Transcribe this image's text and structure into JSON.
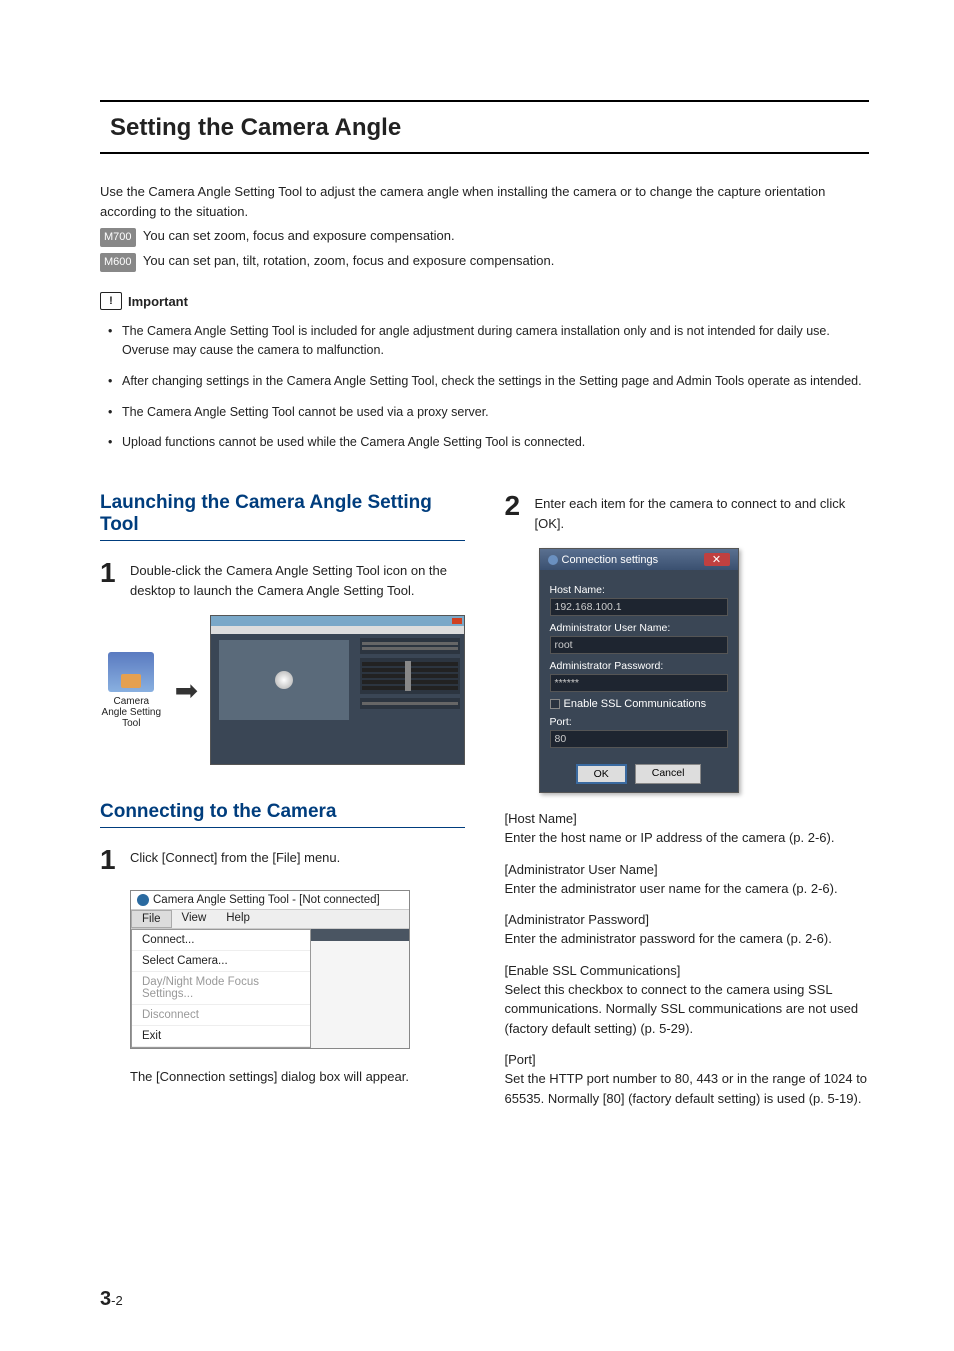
{
  "page": {
    "section_title": "Setting the Camera Angle",
    "intro_line1": "Use the Camera Angle Setting Tool to adjust the camera angle when installing the camera or to change the capture orientation according to the situation.",
    "model_m700": "M700",
    "m700_text": " You can set zoom, focus and exposure compensation.",
    "model_m600": "M600",
    "m600_text": " You can set pan, tilt, rotation, zoom, focus and exposure compensation.",
    "important_label": "Important",
    "important_bullets": [
      "The Camera Angle Setting Tool is included for angle adjustment during camera installation only and is not intended for daily use. Overuse may cause the camera to malfunction.",
      "After changing settings in the Camera Angle Setting Tool, check the settings in the Setting page and Admin Tools operate as intended.",
      "The Camera Angle Setting Tool cannot be used via a proxy server.",
      "Upload functions cannot be used while the Camera Angle Setting Tool is connected."
    ]
  },
  "left": {
    "heading_launch": "Launching the Camera Angle Setting Tool",
    "step1_text": "Double-click the Camera Angle Setting Tool icon on the desktop to launch the Camera Angle Setting Tool.",
    "desktop_icon_label": "Camera Angle Setting Tool",
    "heading_connect": "Connecting to the Camera",
    "connect_step1": "Click [Connect] from the [File] menu.",
    "menu_title": "Camera Angle Setting Tool - [Not connected]",
    "menu_file": "File",
    "menu_view": "View",
    "menu_help": "Help",
    "menu_items": {
      "connect": "Connect...",
      "select": "Select Camera...",
      "daynight": "Day/Night Mode Focus Settings...",
      "disconnect": "Disconnect",
      "exit": "Exit"
    },
    "connect_caption": "The [Connection settings] dialog box will appear."
  },
  "right": {
    "step2_text": "Enter each item for the camera to connect to and click [OK].",
    "dialog": {
      "title": "Connection settings",
      "host_label": "Host Name:",
      "host_value": "192.168.100.1",
      "user_label": "Administrator User Name:",
      "user_value": "root",
      "pass_label": "Administrator Password:",
      "pass_value": "******",
      "ssl_label": "Enable SSL Communications",
      "port_label": "Port:",
      "port_value": "80",
      "ok": "OK",
      "cancel": "Cancel"
    },
    "fields": [
      {
        "title": "[Host Name]",
        "desc": "Enter the host name or IP address of the camera (p. 2-6)."
      },
      {
        "title": "[Administrator User Name]",
        "desc": "Enter the administrator user name for the camera (p. 2-6)."
      },
      {
        "title": "[Administrator Password]",
        "desc": "Enter the administrator password for the camera (p. 2-6)."
      },
      {
        "title": "[Enable SSL Communications]",
        "desc": "Select this checkbox to connect to the camera using SSL communications. Normally SSL communications are not used (factory default setting) (p. 5-29)."
      },
      {
        "title": "[Port]",
        "desc": "Set the HTTP port number to 80, 443 or in the range of 1024 to 65535. Normally [80] (factory default setting) is used (p. 5-19)."
      }
    ]
  },
  "footer": {
    "chapter": "3",
    "page": "-2"
  }
}
